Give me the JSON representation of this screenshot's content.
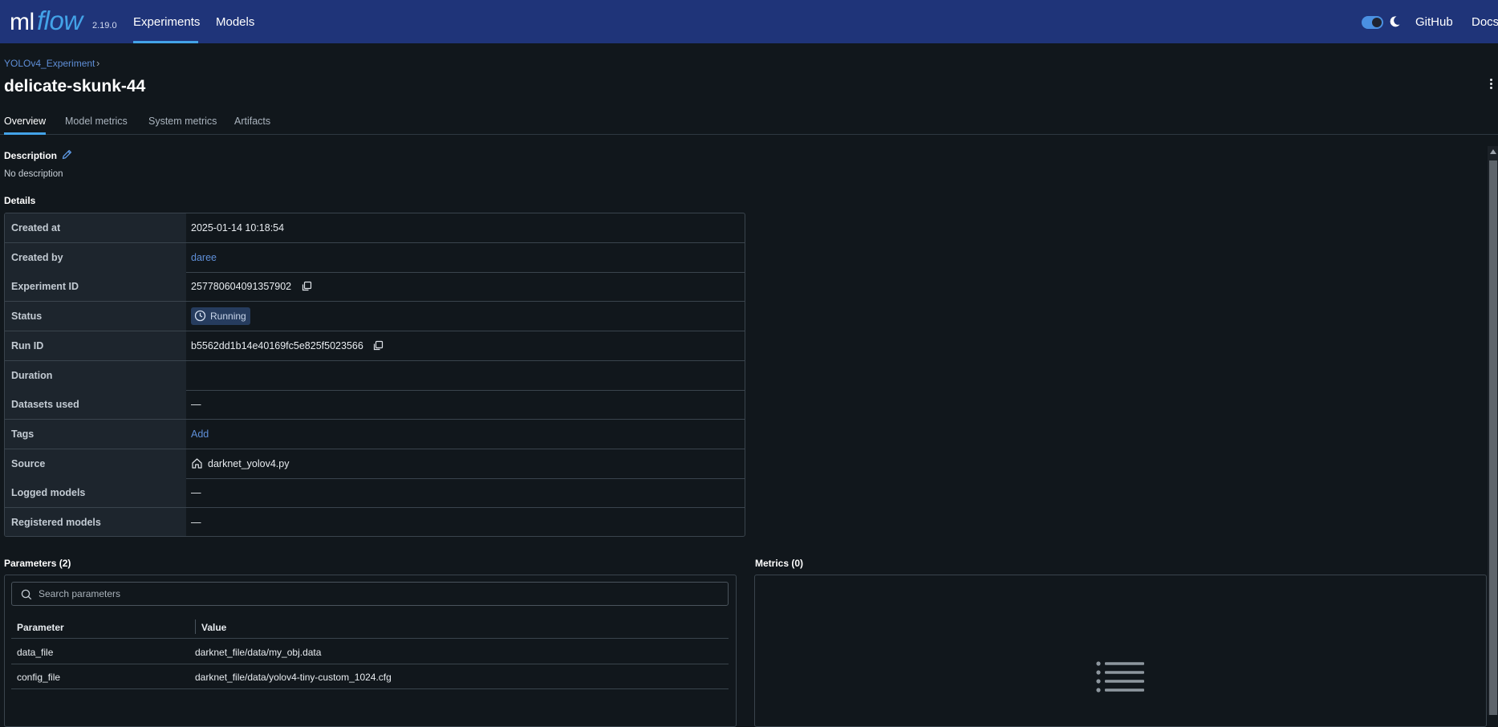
{
  "navbar": {
    "logo_ml": "ml",
    "logo_flow": "flow",
    "version": "2.19.0",
    "links": [
      {
        "label": "Experiments",
        "active": true
      },
      {
        "label": "Models",
        "active": false
      }
    ],
    "theme_toggle_on": true,
    "github_label": "GitHub",
    "docs_label": "Docs",
    "colors": {
      "background": "#1f3479",
      "accent": "#43a3e8"
    }
  },
  "breadcrumb": {
    "experiment": "YOLOv4_Experiment"
  },
  "run": {
    "name": "delicate-skunk-44"
  },
  "tabs": [
    {
      "label": "Overview",
      "active": true
    },
    {
      "label": "Model metrics",
      "active": false
    },
    {
      "label": "System metrics",
      "active": false
    },
    {
      "label": "Artifacts",
      "active": false
    }
  ],
  "description": {
    "label": "Description",
    "text": "No description",
    "edit_icon": "pencil-icon"
  },
  "details": {
    "label": "Details",
    "rows": [
      {
        "key": "Created at",
        "value": "2025-01-14 10:18:54"
      },
      {
        "key": "Created by",
        "value": "daree"
      },
      {
        "key": "Experiment ID",
        "value": "257780604091357902"
      },
      {
        "key": "Status",
        "value": "Running"
      },
      {
        "key": "Run ID",
        "value": "b5562dd1b14e40169fc5e825f5023566"
      },
      {
        "key": "Duration",
        "value": ""
      },
      {
        "key": "Datasets used",
        "value": "—"
      },
      {
        "key": "Tags",
        "value": "Add"
      },
      {
        "key": "Source",
        "value": "darknet_yolov4.py"
      },
      {
        "key": "Logged models",
        "value": "—"
      },
      {
        "key": "Registered models",
        "value": "—"
      }
    ]
  },
  "parameters": {
    "label": "Parameters (2)",
    "search_placeholder": "Search parameters",
    "columns": [
      "Parameter",
      "Value"
    ],
    "rows": [
      {
        "name": "data_file",
        "value": "darknet_file/data/my_obj.data"
      },
      {
        "name": "config_file",
        "value": "darknet_file/data/yolov4-tiny-custom_1024.cfg"
      }
    ]
  },
  "metrics": {
    "label": "Metrics (0)",
    "empty_icon": "list-icon"
  }
}
